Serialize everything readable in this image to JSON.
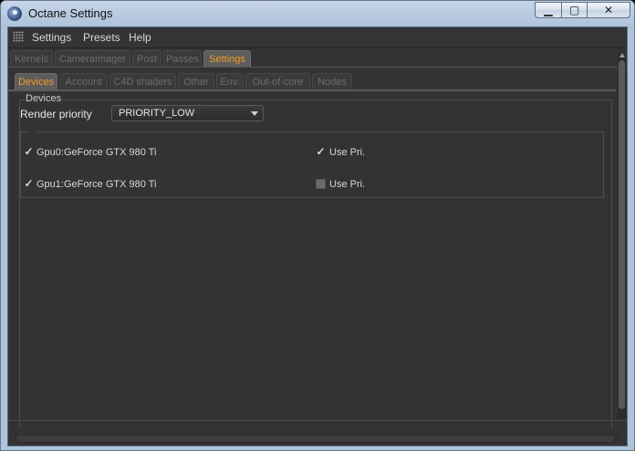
{
  "window": {
    "title": "Octane Settings"
  },
  "menu": [
    "Settings",
    "Presets",
    "Help"
  ],
  "tabs_primary": [
    {
      "label": "Kernels",
      "active": false
    },
    {
      "label": "CameraImager",
      "active": false
    },
    {
      "label": "Post",
      "active": false
    },
    {
      "label": "Passes",
      "active": false
    },
    {
      "label": "Settings",
      "active": true
    }
  ],
  "tabs_secondary": [
    {
      "label": "Devices",
      "active": true
    },
    {
      "label": "Account",
      "active": false
    },
    {
      "label": "C4D shaders",
      "active": false
    },
    {
      "label": "Other",
      "active": false
    },
    {
      "label": "Env.",
      "active": false
    },
    {
      "label": "Out-of-core",
      "active": false
    },
    {
      "label": "Nodes",
      "active": false
    }
  ],
  "devices": {
    "group_title": "Devices",
    "render_priority_label": "Render priority",
    "render_priority_value": "PRIORITY_LOW",
    "gpus": [
      {
        "name": "Gpu0:GeForce GTX 980 Ti",
        "enabled": true,
        "use_pri_label": "Use Pri.",
        "use_pri": true
      },
      {
        "name": "Gpu1:GeForce GTX 980 Ti",
        "enabled": true,
        "use_pri_label": "Use Pri.",
        "use_pri": false
      }
    ]
  },
  "colors": {
    "accent": "#f09c1e",
    "background": "#333333"
  }
}
